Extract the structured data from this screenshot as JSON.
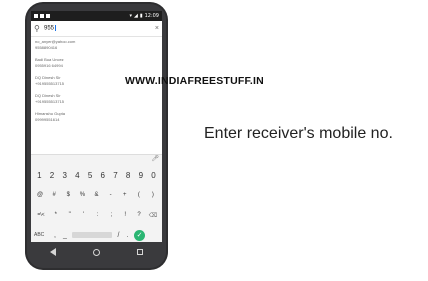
{
  "status": {
    "time": "12:09"
  },
  "search": {
    "query": "955",
    "clear_icon": "×",
    "search_icon": "search-icon"
  },
  "contacts": [
    {
      "name": "no_anyer@yahoo.com",
      "phone": "9558890416"
    },
    {
      "name": "Badi Bua Uncez",
      "phone": "0955916 64994"
    },
    {
      "name": "DQ Dinesh Sir",
      "phone": "+919555513715"
    },
    {
      "name": "DQ Dinesh Sir",
      "phone": "+919555513715"
    },
    {
      "name": "Himanshu Gupta",
      "phone": "09999551614"
    }
  ],
  "keyboard": {
    "mic": "mic-icon",
    "row1": [
      "1",
      "2",
      "3",
      "4",
      "5",
      "6",
      "7",
      "8",
      "9",
      "0"
    ],
    "row2": [
      "@",
      "#",
      "$",
      "%",
      "&",
      "-",
      "+",
      "(",
      ")"
    ],
    "row3": [
      "=\\<",
      "*",
      "\"",
      "'",
      ":",
      ";",
      "!",
      "?",
      "⌫"
    ],
    "bottom": {
      "abc": "ABC",
      "comma": ",",
      "under": "_",
      "slash": "/",
      "dot": ".",
      "go": "✓"
    }
  },
  "watermark": "WWW.INDIAFREESTUFF.IN",
  "caption": "Enter receiver's mobile no."
}
